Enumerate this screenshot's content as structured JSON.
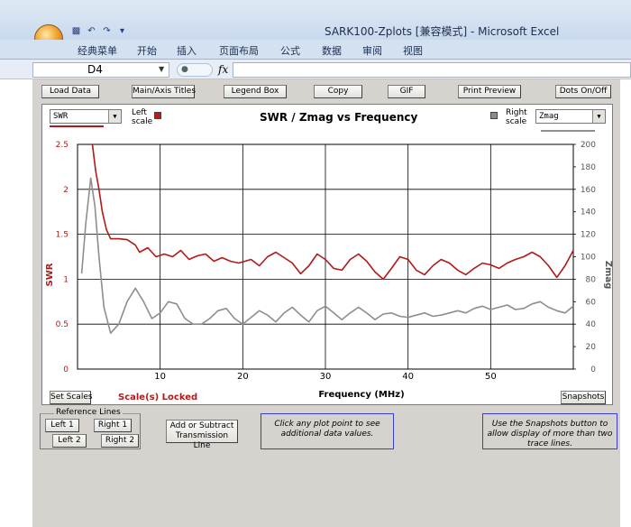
{
  "window": {
    "title": "SARK100-Zplots  [兼容模式] - Microsoft Excel"
  },
  "ribbon": {
    "tabs": [
      "经典菜单",
      "开始",
      "插入",
      "页面布局",
      "公式",
      "数据",
      "审阅",
      "视图"
    ]
  },
  "formula_bar": {
    "name_box": "D4",
    "fx": "fx",
    "value": ""
  },
  "toolbar": {
    "buttons": [
      "Load Data",
      "Main/Axis Titles",
      "Legend Box",
      "Copy",
      "GIF",
      "Print Preview",
      "Dots On/Off"
    ]
  },
  "chart_panel": {
    "left_combo": "SWR",
    "left_scale_label": "Left scale",
    "right_scale_label": "Right scale",
    "right_combo": "Zmag",
    "set_scales": "Set Scales",
    "scale_locked": "Scale(s) Locked",
    "snapshots": "Snapshots"
  },
  "reference_lines": {
    "title": "Reference Lines",
    "buttons": [
      "Left 1",
      "Right 1",
      "Left 2",
      "Right 2"
    ]
  },
  "add_subtract": "Add or Subtract Transmission Line",
  "notes": {
    "click_hint": "Click any plot point to see additional data values.",
    "snapshot_hint": "Use the Snapshots button to allow display of more than two trace lines."
  },
  "colors": {
    "swr": "#b01a1a",
    "zmag": "#8e8e8e",
    "left_swatch": "#c0181c",
    "right_swatch": "#8a8a8a",
    "note_border": "#3d3dcc",
    "panel_bg": "#d6d3ce"
  },
  "chart_data": {
    "type": "line",
    "title": "SWR / Zmag  vs  Frequency",
    "xlabel": "Frequency (MHz)",
    "ylabel_left": "SWR",
    "ylabel_right": "Zmag",
    "xlim": [
      0,
      60
    ],
    "ylim_left": [
      0,
      2.5
    ],
    "ylim_right": [
      0,
      200
    ],
    "x_ticks": [
      10,
      20,
      30,
      40,
      50
    ],
    "y_left_ticks": [
      "0",
      "0.5",
      "1",
      "1.5",
      "2",
      "2.5"
    ],
    "y_right_ticks": [
      "0",
      "20",
      "40",
      "60",
      "80",
      "100",
      "120",
      "140",
      "160",
      "180",
      "200"
    ],
    "grid": true,
    "series": [
      {
        "name": "SWR",
        "axis": "left",
        "points": [
          [
            1.8,
            2.5
          ],
          [
            2.2,
            2.2
          ],
          [
            2.6,
            2.0
          ],
          [
            3.0,
            1.75
          ],
          [
            3.5,
            1.55
          ],
          [
            4.0,
            1.45
          ],
          [
            5,
            1.45
          ],
          [
            6,
            1.44
          ],
          [
            7,
            1.38
          ],
          [
            7.5,
            1.3
          ],
          [
            8.5,
            1.35
          ],
          [
            9.5,
            1.25
          ],
          [
            10.5,
            1.28
          ],
          [
            11.5,
            1.25
          ],
          [
            12.5,
            1.32
          ],
          [
            13.5,
            1.22
          ],
          [
            14.5,
            1.26
          ],
          [
            15.5,
            1.28
          ],
          [
            16.5,
            1.2
          ],
          [
            17.5,
            1.24
          ],
          [
            18.5,
            1.2
          ],
          [
            19.5,
            1.18
          ],
          [
            21,
            1.22
          ],
          [
            22,
            1.15
          ],
          [
            23,
            1.25
          ],
          [
            24,
            1.3
          ],
          [
            25,
            1.24
          ],
          [
            26,
            1.18
          ],
          [
            27,
            1.06
          ],
          [
            28,
            1.15
          ],
          [
            29,
            1.28
          ],
          [
            30,
            1.22
          ],
          [
            31,
            1.12
          ],
          [
            32,
            1.1
          ],
          [
            33,
            1.22
          ],
          [
            34,
            1.28
          ],
          [
            35,
            1.2
          ],
          [
            36,
            1.08
          ],
          [
            37,
            1.0
          ],
          [
            38,
            1.12
          ],
          [
            39,
            1.25
          ],
          [
            40,
            1.22
          ],
          [
            41,
            1.1
          ],
          [
            42,
            1.05
          ],
          [
            43,
            1.15
          ],
          [
            44,
            1.22
          ],
          [
            45,
            1.18
          ],
          [
            46,
            1.1
          ],
          [
            47,
            1.05
          ],
          [
            48,
            1.12
          ],
          [
            49,
            1.18
          ],
          [
            50,
            1.16
          ],
          [
            51,
            1.12
          ],
          [
            52,
            1.18
          ],
          [
            53,
            1.22
          ],
          [
            54,
            1.25
          ],
          [
            55,
            1.3
          ],
          [
            56,
            1.25
          ],
          [
            57,
            1.15
          ],
          [
            58,
            1.02
          ],
          [
            59,
            1.15
          ],
          [
            60,
            1.32
          ]
        ]
      },
      {
        "name": "Zmag",
        "axis": "right",
        "points": [
          [
            0.5,
            85
          ],
          [
            1.0,
            130
          ],
          [
            1.6,
            170
          ],
          [
            2.1,
            145
          ],
          [
            2.6,
            100
          ],
          [
            3.2,
            55
          ],
          [
            4.0,
            32
          ],
          [
            5,
            40
          ],
          [
            6,
            60
          ],
          [
            7,
            72
          ],
          [
            8,
            60
          ],
          [
            9,
            45
          ],
          [
            10,
            50
          ],
          [
            11,
            60
          ],
          [
            12,
            58
          ],
          [
            13,
            45
          ],
          [
            14,
            40
          ],
          [
            15,
            40
          ],
          [
            16,
            45
          ],
          [
            17,
            52
          ],
          [
            18,
            54
          ],
          [
            19,
            45
          ],
          [
            20,
            40
          ],
          [
            21,
            46
          ],
          [
            22,
            52
          ],
          [
            23,
            48
          ],
          [
            24,
            42
          ],
          [
            25,
            50
          ],
          [
            26,
            55
          ],
          [
            27,
            48
          ],
          [
            28,
            42
          ],
          [
            29,
            52
          ],
          [
            30,
            56
          ],
          [
            31,
            50
          ],
          [
            32,
            44
          ],
          [
            33,
            50
          ],
          [
            34,
            55
          ],
          [
            35,
            50
          ],
          [
            36,
            44
          ],
          [
            37,
            49
          ],
          [
            38,
            50
          ],
          [
            39,
            47
          ],
          [
            40,
            46
          ],
          [
            41,
            48
          ],
          [
            42,
            50
          ],
          [
            43,
            47
          ],
          [
            44,
            48
          ],
          [
            45,
            50
          ],
          [
            46,
            52
          ],
          [
            47,
            50
          ],
          [
            48,
            54
          ],
          [
            49,
            56
          ],
          [
            50,
            53
          ],
          [
            51,
            55
          ],
          [
            52,
            57
          ],
          [
            53,
            53
          ],
          [
            54,
            54
          ],
          [
            55,
            58
          ],
          [
            56,
            60
          ],
          [
            57,
            55
          ],
          [
            58,
            52
          ],
          [
            59,
            50
          ],
          [
            60,
            56
          ]
        ]
      }
    ]
  }
}
